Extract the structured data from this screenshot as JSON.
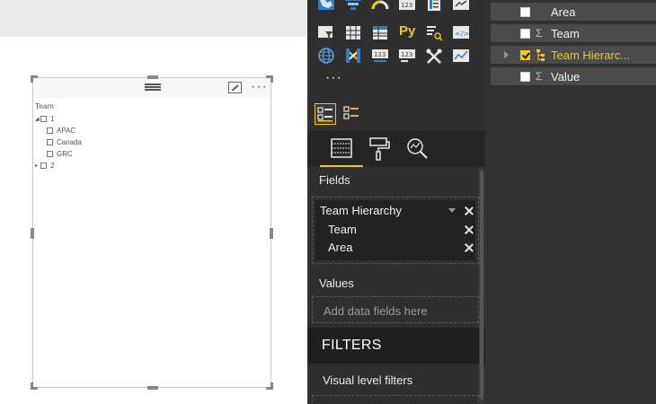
{
  "canvas": {
    "slicer": {
      "title": "Team",
      "items": [
        {
          "label": "1",
          "expanded": true
        },
        {
          "label": "APAC"
        },
        {
          "label": "Canada"
        },
        {
          "label": "GRC"
        },
        {
          "label": "2",
          "expanded": false
        }
      ]
    },
    "more_options_glyph": "···"
  },
  "visualizations": {
    "more_glyph": "···",
    "python_label": "Py",
    "fields_section": {
      "title": "Fields",
      "hierarchy": "Team Hierarchy",
      "items": [
        "Team",
        "Area"
      ]
    },
    "values_section": {
      "title": "Values",
      "placeholder": "Add data fields here"
    },
    "filters": {
      "title": "FILTERS",
      "visual_level": "Visual level filters"
    }
  },
  "fields_list": [
    {
      "label": "Area",
      "checked": false,
      "icon": "none"
    },
    {
      "label": "Team",
      "checked": false,
      "icon": "sigma"
    },
    {
      "label": "Team Hierarc...",
      "checked": true,
      "icon": "hierarchy"
    },
    {
      "label": "Value",
      "checked": false,
      "icon": "sigma"
    }
  ],
  "colors": {
    "accent": "#f2c811",
    "pane_bg": "#2f2f2f",
    "canvas_bg": "#ffffff"
  }
}
